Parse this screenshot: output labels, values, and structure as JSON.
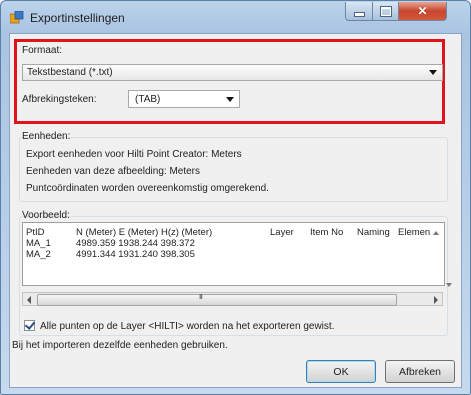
{
  "window": {
    "title": "Exportinstellingen"
  },
  "format": {
    "label": "Formaat:",
    "selected": "Tekstbestand (*.txt)",
    "separator_label": "Afbrekingsteken:",
    "separator_value": "(TAB)"
  },
  "units": {
    "heading": "Eenheden:",
    "lines": [
      "Export eenheden voor Hilti Point Creator: Meters",
      "Eenheden van deze afbeelding: Meters",
      "Puntcoördinaten worden overeenkomstig omgerekend."
    ]
  },
  "preview": {
    "heading": "Voorbeeld:",
    "columns": [
      "PtID",
      "N (Meter) E (Meter) H(z) (Meter)",
      "Layer",
      "Item No",
      "Naming",
      "Elemen"
    ],
    "rows": [
      {
        "id": "MA_1",
        "values": "4989.359 1938.244 398.372"
      },
      {
        "id": "MA_2",
        "values": "4991.344 1931.240 398.305"
      }
    ],
    "scroll_grip": "III"
  },
  "options": {
    "delete_points": "Alle punten op de Layer <HILTI> worden na het exporteren gewist.",
    "delete_checked": true,
    "import_note": "Bij het importeren dezelfde eenheden gebruiken."
  },
  "buttons": {
    "ok": "OK",
    "cancel": "Afbreken"
  },
  "colors": {
    "highlight": "#e0141b",
    "close_button": "#c6462e"
  }
}
